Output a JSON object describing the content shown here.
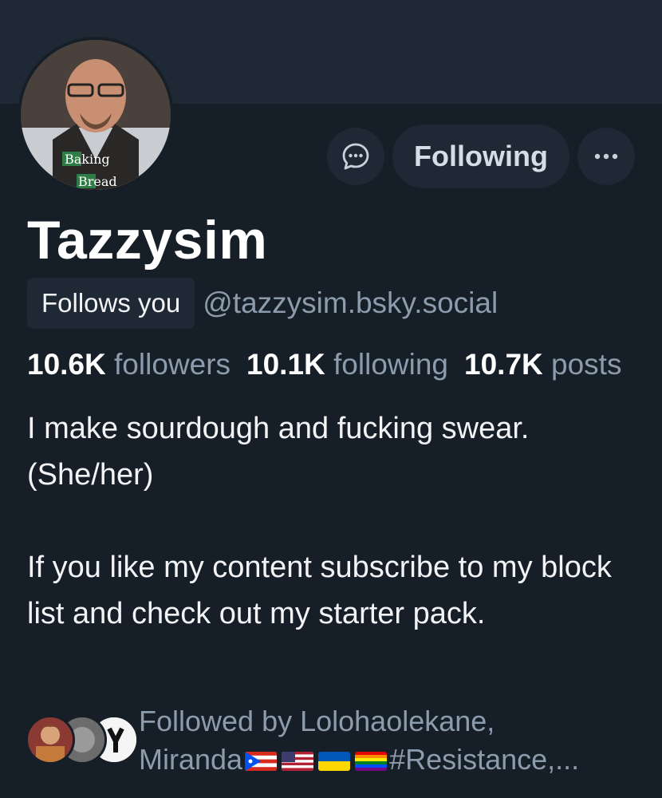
{
  "profile": {
    "display_name": "Tazzysim",
    "follows_you_label": "Follows you",
    "handle": "@tazzysim.bsky.social",
    "avatar_text_line1": "Baking",
    "avatar_text_line2": "Bread"
  },
  "actions": {
    "message_icon": "message-bubble-icon",
    "follow_label": "Following",
    "more_icon": "more-dots-icon"
  },
  "stats": {
    "followers_count": "10.6K",
    "followers_label": "followers",
    "following_count": "10.1K",
    "following_label": "following",
    "posts_count": "10.7K",
    "posts_label": "posts"
  },
  "bio": {
    "line1": "I make sourdough and fucking swear.",
    "line2": "(She/her)",
    "line3": "If you like my content subscribe to my block list and check out my starter pack."
  },
  "followed_by": {
    "line1": "Followed by Lolohaolekane,",
    "line2_name": "Miranda",
    "line2_suffix": "#Resistance,..."
  },
  "colors": {
    "background": "#161e27",
    "banner": "#1e2935",
    "muted_text": "#8d9cad",
    "button_bg": "#1e2935"
  }
}
